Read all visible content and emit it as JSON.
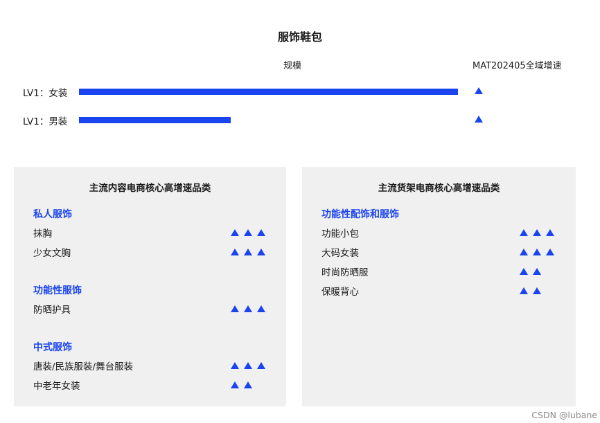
{
  "title": "服饰鞋包",
  "colors": {
    "accent": "#1a44f0",
    "panel_bg": "#f0f0f0"
  },
  "chart_data": {
    "type": "bar",
    "orientation": "horizontal",
    "title": "服饰鞋包",
    "value_header": "规模",
    "growth_header": "MAT202405全域增速",
    "categories": [
      "LV1：女装",
      "LV1：男装"
    ],
    "values": [
      100,
      40
    ],
    "growth_icons": [
      "triangle-up-icon",
      "triangle-up-icon"
    ],
    "xlim": [
      0,
      100
    ]
  },
  "panels": [
    {
      "title": "主流内容电商核心高增速品类",
      "groups": [
        {
          "heading": "私人服饰",
          "items": [
            {
              "label": "抹胸",
              "triangles": 3
            },
            {
              "label": "少女文胸",
              "triangles": 3
            }
          ]
        },
        {
          "heading": "功能性服饰",
          "items": [
            {
              "label": "防晒护具",
              "triangles": 3
            }
          ]
        },
        {
          "heading": "中式服饰",
          "items": [
            {
              "label": "唐装/民族服装/舞台服装",
              "triangles": 3
            },
            {
              "label": "中老年女装",
              "triangles": 2
            }
          ]
        }
      ]
    },
    {
      "title": "主流货架电商核心高增速品类",
      "groups": [
        {
          "heading": "功能性配饰和服饰",
          "items": [
            {
              "label": "功能小包",
              "triangles": 3
            },
            {
              "label": "大码女装",
              "triangles": 3
            },
            {
              "label": "时尚防晒服",
              "triangles": 2
            },
            {
              "label": "保暖背心",
              "triangles": 2
            }
          ]
        }
      ]
    }
  ],
  "watermark": "CSDN @lubane"
}
